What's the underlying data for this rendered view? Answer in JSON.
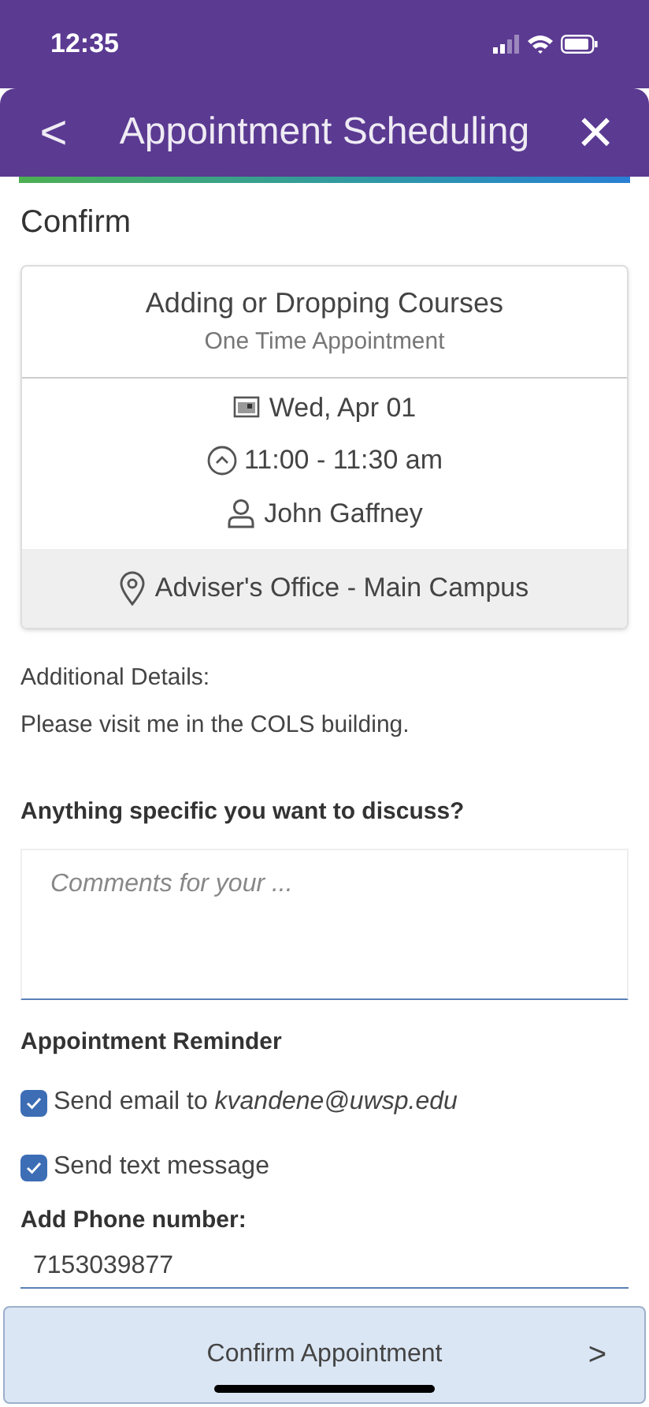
{
  "status_bar": {
    "time": "12:35"
  },
  "header": {
    "back": "<",
    "title": "Appointment Scheduling",
    "close": "×"
  },
  "section_title": "Confirm",
  "card": {
    "title": "Adding or Dropping Courses",
    "subtitle": "One Time Appointment",
    "date": "Wed, Apr 01",
    "time": "11:00 - 11:30 am",
    "adviser": "John Gaffney",
    "location": "Adviser's Office - Main Campus"
  },
  "details": {
    "label": "Additional Details:",
    "text": "Please visit me in the COLS building."
  },
  "discuss": {
    "label": "Anything specific you want to discuss?",
    "placeholder": "Comments for your ..."
  },
  "reminder": {
    "title": "Appointment Reminder",
    "options": [
      {
        "label": "Send email to *kvandene@uwsp.edu*",
        "checked": true
      },
      {
        "label": "Send text message",
        "checked": true
      }
    ]
  },
  "phone": {
    "label": "Add Phone number:",
    "value": "7153039877"
  },
  "confirm_button": {
    "label": "Confirm Appointment",
    "arrow": ">"
  }
}
